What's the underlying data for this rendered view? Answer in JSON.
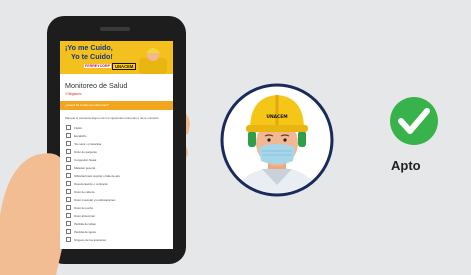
{
  "colors": {
    "background": "#e6e7e9",
    "banner_yellow": "#f4c01e",
    "banner_blue": "#123a7a",
    "form_accent_orange": "#f2a51e",
    "check_green": "#38b24a",
    "helmet_yellow": "#f5c518",
    "circle_border": "#1a2a5a"
  },
  "banner": {
    "title_line1": "¡Yo me Cuido,",
    "title_line2": "Yo te Cuido!",
    "brand_left": "FERREYCORP",
    "brand_right": "UNACEM"
  },
  "form": {
    "title": "Monitoreo de Salud",
    "required_note": "*Obligatorio",
    "section_header": "¿Usted ha tenido los síntomas?",
    "question": "Marque si presenta alguno de los siguientes síntomas o tiene contacto",
    "options": [
      "Fiebre",
      "Escalofrío",
      "Tos seca o productiva",
      "Dolor de garganta",
      "Congestión Nasal",
      "Malestar general",
      "Dificultad para respirar o falta de aire",
      "Desorientación o confusión",
      "Dolor de cabeza",
      "Dolor muscular y/o articulaciones",
      "Dolor de pecho",
      "Dolor abdominal",
      "Pérdida del olfato",
      "Pérdida del gusto",
      "Ninguno de los anteriores"
    ]
  },
  "avatar": {
    "icon": "worker-with-mask-icon",
    "helmet_logo": "UNACEM"
  },
  "status": {
    "icon": "check-icon",
    "label": "Apto"
  }
}
